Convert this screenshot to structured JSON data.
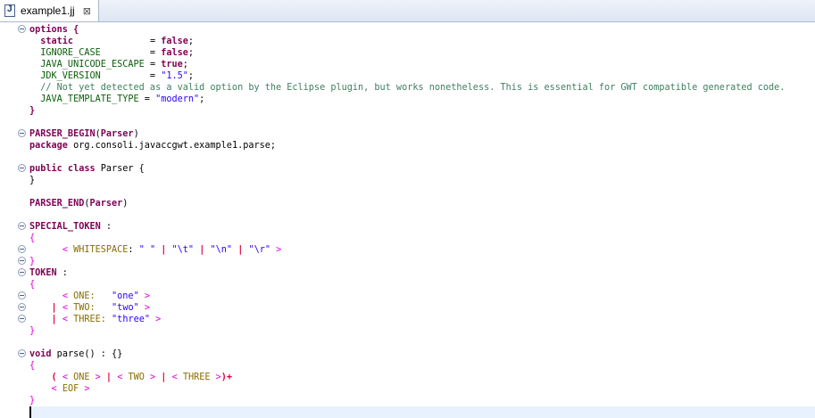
{
  "tab": {
    "title": "example1.jj",
    "close_glyph": "⊠",
    "icon": "java-cc-file-icon"
  },
  "colors": {
    "keyword": "#7f0055",
    "option": "#0a5e0a",
    "string": "#2a00ff",
    "comment": "#3f7f5f",
    "brace": "#e000e0",
    "token": "#8a6c00",
    "choice": "#e0003a"
  },
  "lines": [
    {
      "fold": true,
      "spans": [
        {
          "c": "kw",
          "t": "options {"
        }
      ]
    },
    {
      "fold": false,
      "spans": [
        {
          "c": "kw",
          "t": "  static"
        },
        {
          "c": "pl",
          "t": "              = "
        },
        {
          "c": "kw",
          "t": "false"
        },
        {
          "c": "pl",
          "t": ";"
        }
      ]
    },
    {
      "fold": false,
      "spans": [
        {
          "c": "opt",
          "t": "  IGNORE_CASE"
        },
        {
          "c": "pl",
          "t": "         = "
        },
        {
          "c": "kw",
          "t": "false"
        },
        {
          "c": "pl",
          "t": ";"
        }
      ]
    },
    {
      "fold": false,
      "spans": [
        {
          "c": "opt",
          "t": "  JAVA_UNICODE_ESCAPE"
        },
        {
          "c": "pl",
          "t": " = "
        },
        {
          "c": "kw",
          "t": "true"
        },
        {
          "c": "pl",
          "t": ";"
        }
      ]
    },
    {
      "fold": false,
      "spans": [
        {
          "c": "opt",
          "t": "  JDK_VERSION"
        },
        {
          "c": "pl",
          "t": "         = "
        },
        {
          "c": "str",
          "t": "\"1.5\""
        },
        {
          "c": "pl",
          "t": ";"
        }
      ]
    },
    {
      "fold": false,
      "spans": [
        {
          "c": "com",
          "t": "  // Not yet detected as a valid option by the Eclipse plugin, but works nonetheless. This is essential for GWT compatible generated code."
        }
      ]
    },
    {
      "fold": false,
      "spans": [
        {
          "c": "opt",
          "t": "  JAVA_TEMPLATE_TYPE"
        },
        {
          "c": "pl",
          "t": " = "
        },
        {
          "c": "str",
          "t": "\"modern\""
        },
        {
          "c": "pl",
          "t": ";"
        }
      ]
    },
    {
      "fold": false,
      "spans": [
        {
          "c": "kw",
          "t": "}"
        }
      ]
    },
    {
      "fold": false,
      "spans": []
    },
    {
      "fold": true,
      "spans": [
        {
          "c": "kw",
          "t": "PARSER_BEGIN"
        },
        {
          "c": "pl",
          "t": "("
        },
        {
          "c": "kw",
          "t": "Parser"
        },
        {
          "c": "pl",
          "t": ")"
        }
      ]
    },
    {
      "fold": false,
      "spans": [
        {
          "c": "kw",
          "t": "package"
        },
        {
          "c": "pl",
          "t": " org.consoli.javaccgwt.example1.parse;"
        }
      ]
    },
    {
      "fold": false,
      "spans": []
    },
    {
      "fold": true,
      "spans": [
        {
          "c": "kw",
          "t": "public class"
        },
        {
          "c": "pl",
          "t": " Parser {"
        }
      ]
    },
    {
      "fold": false,
      "spans": [
        {
          "c": "pl",
          "t": "}"
        }
      ]
    },
    {
      "fold": false,
      "spans": []
    },
    {
      "fold": false,
      "spans": [
        {
          "c": "kw",
          "t": "PARSER_END"
        },
        {
          "c": "pl",
          "t": "("
        },
        {
          "c": "kw",
          "t": "Parser"
        },
        {
          "c": "pl",
          "t": ")"
        }
      ]
    },
    {
      "fold": false,
      "spans": []
    },
    {
      "fold": true,
      "spans": [
        {
          "c": "kw",
          "t": "SPECIAL_TOKEN"
        },
        {
          "c": "pl",
          "t": " :"
        }
      ]
    },
    {
      "fold": false,
      "spans": [
        {
          "c": "mg",
          "t": "{"
        }
      ]
    },
    {
      "fold": true,
      "spans": [
        {
          "c": "pl",
          "t": "      "
        },
        {
          "c": "mg",
          "t": "<"
        },
        {
          "c": "tk",
          "t": " WHITESPACE"
        },
        {
          "c": "pl",
          "t": ": "
        },
        {
          "c": "str",
          "t": "\" \""
        },
        {
          "c": "pl",
          "t": " "
        },
        {
          "c": "red",
          "t": "|"
        },
        {
          "c": "pl",
          "t": " "
        },
        {
          "c": "str",
          "t": "\"\\t\""
        },
        {
          "c": "pl",
          "t": " "
        },
        {
          "c": "red",
          "t": "|"
        },
        {
          "c": "pl",
          "t": " "
        },
        {
          "c": "str",
          "t": "\"\\n\""
        },
        {
          "c": "pl",
          "t": " "
        },
        {
          "c": "red",
          "t": "|"
        },
        {
          "c": "pl",
          "t": " "
        },
        {
          "c": "str",
          "t": "\"\\r\""
        },
        {
          "c": "pl",
          "t": " "
        },
        {
          "c": "mg",
          "t": ">"
        }
      ]
    },
    {
      "fold": true,
      "spans": [
        {
          "c": "mg",
          "t": "}"
        }
      ]
    },
    {
      "fold": true,
      "spans": [
        {
          "c": "kw",
          "t": "TOKEN"
        },
        {
          "c": "pl",
          "t": " :"
        }
      ]
    },
    {
      "fold": false,
      "spans": [
        {
          "c": "mg",
          "t": "{"
        }
      ]
    },
    {
      "fold": true,
      "spans": [
        {
          "c": "pl",
          "t": "      "
        },
        {
          "c": "mg",
          "t": "<"
        },
        {
          "c": "tk",
          "t": " ONE:"
        },
        {
          "c": "pl",
          "t": "   "
        },
        {
          "c": "str",
          "t": "\"one\""
        },
        {
          "c": "pl",
          "t": " "
        },
        {
          "c": "mg",
          "t": ">"
        }
      ]
    },
    {
      "fold": true,
      "spans": [
        {
          "c": "pl",
          "t": "    "
        },
        {
          "c": "red",
          "t": "|"
        },
        {
          "c": "pl",
          "t": " "
        },
        {
          "c": "mg",
          "t": "<"
        },
        {
          "c": "tk",
          "t": " TWO:"
        },
        {
          "c": "pl",
          "t": "   "
        },
        {
          "c": "str",
          "t": "\"two\""
        },
        {
          "c": "pl",
          "t": " "
        },
        {
          "c": "mg",
          "t": ">"
        }
      ]
    },
    {
      "fold": true,
      "spans": [
        {
          "c": "pl",
          "t": "    "
        },
        {
          "c": "red",
          "t": "|"
        },
        {
          "c": "pl",
          "t": " "
        },
        {
          "c": "mg",
          "t": "<"
        },
        {
          "c": "tk",
          "t": " THREE:"
        },
        {
          "c": "pl",
          "t": " "
        },
        {
          "c": "str",
          "t": "\"three\""
        },
        {
          "c": "pl",
          "t": " "
        },
        {
          "c": "mg",
          "t": ">"
        }
      ]
    },
    {
      "fold": false,
      "spans": [
        {
          "c": "mg",
          "t": "}"
        }
      ]
    },
    {
      "fold": false,
      "spans": []
    },
    {
      "fold": true,
      "spans": [
        {
          "c": "kw",
          "t": "void"
        },
        {
          "c": "pl",
          "t": " parse() : {}"
        }
      ]
    },
    {
      "fold": false,
      "spans": [
        {
          "c": "mg",
          "t": "{"
        }
      ]
    },
    {
      "fold": false,
      "spans": [
        {
          "c": "pl",
          "t": "    "
        },
        {
          "c": "red",
          "t": "("
        },
        {
          "c": "pl",
          "t": " "
        },
        {
          "c": "mg",
          "t": "<"
        },
        {
          "c": "tk",
          "t": " ONE "
        },
        {
          "c": "mg",
          "t": ">"
        },
        {
          "c": "pl",
          "t": " "
        },
        {
          "c": "red",
          "t": "|"
        },
        {
          "c": "pl",
          "t": " "
        },
        {
          "c": "mg",
          "t": "<"
        },
        {
          "c": "tk",
          "t": " TWO "
        },
        {
          "c": "mg",
          "t": ">"
        },
        {
          "c": "pl",
          "t": " "
        },
        {
          "c": "red",
          "t": "|"
        },
        {
          "c": "pl",
          "t": " "
        },
        {
          "c": "mg",
          "t": "<"
        },
        {
          "c": "tk",
          "t": " THREE "
        },
        {
          "c": "mg",
          "t": ">"
        },
        {
          "c": "red",
          "t": ")+"
        }
      ]
    },
    {
      "fold": false,
      "spans": [
        {
          "c": "pl",
          "t": "    "
        },
        {
          "c": "mg",
          "t": "<"
        },
        {
          "c": "tk",
          "t": " EOF "
        },
        {
          "c": "mg",
          "t": ">"
        }
      ]
    },
    {
      "fold": false,
      "spans": [
        {
          "c": "mg",
          "t": "}"
        }
      ]
    },
    {
      "fold": false,
      "spans": [],
      "current": true
    }
  ]
}
